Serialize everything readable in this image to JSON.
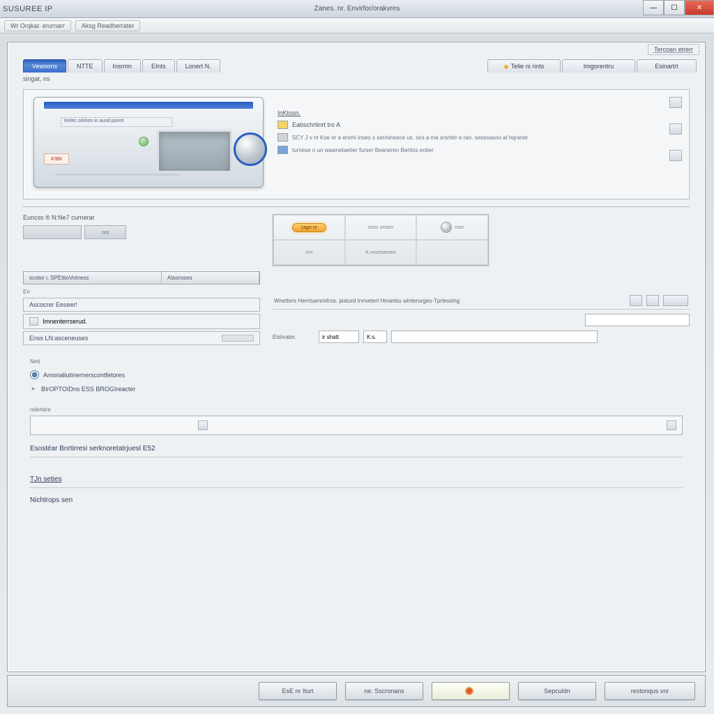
{
  "titlebar": {
    "left": "SUSUREE IP",
    "center": "Zanes. nr. Envirfor/orakvres"
  },
  "subtabs": {
    "a": "Wr Orqkar. erurnarr",
    "b": "Aksg Readherrater"
  },
  "helper": "Tercoan etrerr",
  "tabs": {
    "active": "Vewsons",
    "t1": "NTTE",
    "t2": "Insrmn",
    "t3": "EInts",
    "t4": "Lonert N.",
    "r1": "Telie ni rints",
    "r2": "Imgorentru",
    "r3": "Esinartrt"
  },
  "subheader": "singat, ns",
  "hero": {
    "device": {
      "label": "Ketec orkrion in ausd porint",
      "badge": "K/8bi"
    },
    "model": "InKtosn.",
    "line1": "Eabschrtinrt tro A",
    "line2": "SCY J v nt Koe er a ersmi inses s serminesce us. sirs a ma srsrtetr e ran. sesesasoo al hqraner",
    "line3": "turnese n un wawnetaetier furser Beaneren Bertins entier"
  },
  "midleft": {
    "section": "Euncss ® N:Ne7 curnerar",
    "brick_label": "nm",
    "col_a": "scotor i. SPEttioVotness",
    "col_b": "Atsoroses",
    "caption": "En",
    "row1": "Ascocrer Eeseer!",
    "row1_sub": "Imnenterrserud.",
    "row2": "Enss LN:asceneuses"
  },
  "cardlet": {
    "pill": "cago re",
    "c1": "sons orsom",
    "c2": "rssn",
    "c3": "nrn",
    "c4": "K msresemen",
    "c5": ""
  },
  "midright": {
    "desc": "Wnetters Herr/sammitros. pisturd Innveterl Hmanbu winterurges-Tprtessing",
    "inp_label": "Eishrater.",
    "inp2_label": "ir shatt",
    "inp3_label": "K:s."
  },
  "radios": {
    "caption": "Neti",
    "opt1": "Amonaliutinernerscontfetores",
    "opt2": "BIrOPTOIDns ESS BROGIreacter"
  },
  "notes_label": "ndertare",
  "sect1": "Esostéar Bnrtirresi serknoretatrjuesl E52",
  "sect2": "TJn seties",
  "sect3": "Nichtrops sen",
  "footer": {
    "b1": "EsE nr Iturt",
    "b2": "ne. Sscronans",
    "b3": "",
    "b4": "Sepculdn",
    "b5": "restonqus vnr"
  }
}
